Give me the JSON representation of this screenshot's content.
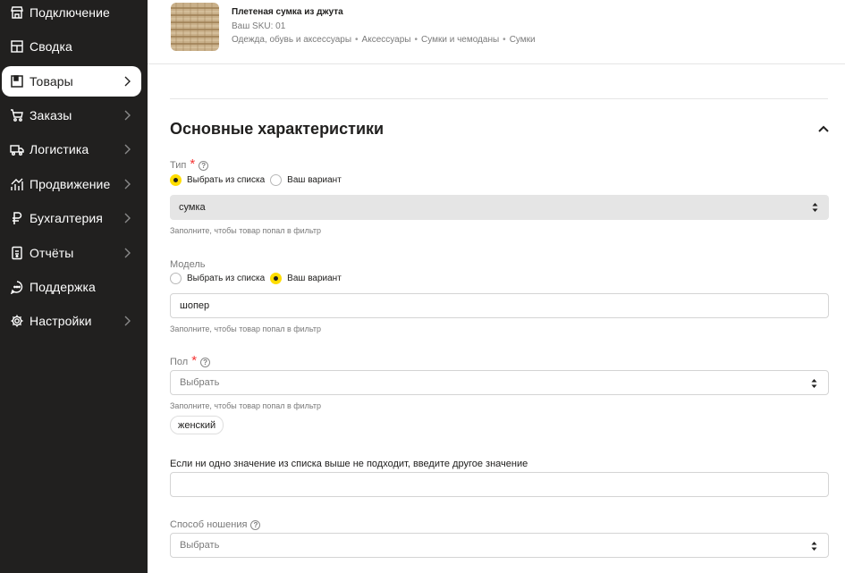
{
  "sidebar": {
    "items": [
      {
        "label": "Подключение",
        "icon": "store-icon",
        "chevron": false
      },
      {
        "label": "Сводка",
        "icon": "summary-icon",
        "chevron": false
      },
      {
        "label": "Товары",
        "icon": "box-icon",
        "chevron": true,
        "active": true
      },
      {
        "label": "Заказы",
        "icon": "cart-icon",
        "chevron": true
      },
      {
        "label": "Логистика",
        "icon": "truck-icon",
        "chevron": true
      },
      {
        "label": "Продвижение",
        "icon": "growth-icon",
        "chevron": true
      },
      {
        "label": "Бухгалтерия",
        "icon": "ruble-icon",
        "chevron": true
      },
      {
        "label": "Отчёты",
        "icon": "report-icon",
        "chevron": true
      },
      {
        "label": "Поддержка",
        "icon": "chat-icon",
        "chevron": false
      },
      {
        "label": "Настройки",
        "icon": "gear-icon",
        "chevron": true
      }
    ]
  },
  "product": {
    "title": "Плетеная сумка из джута",
    "sku": "Ваш SKU: 01",
    "breadcrumb": [
      "Одежда, обувь и аксессуары",
      "Аксессуары",
      "Сумки и чемоданы",
      "Сумки"
    ],
    "separator": "•"
  },
  "section": {
    "title": "Основные характеристики"
  },
  "fields": {
    "type": {
      "label": "Тип",
      "required_mark": "*",
      "help": "?",
      "radio_list": "Выбрать из списка",
      "radio_custom": "Ваш вариант",
      "selected_mode": "list",
      "value": "сумка",
      "hint": "Заполните, чтобы товар попал в фильтр"
    },
    "model": {
      "label": "Модель",
      "radio_list": "Выбрать из списка",
      "radio_custom": "Ваш вариант",
      "selected_mode": "custom",
      "value": "шопер",
      "hint": "Заполните, чтобы товар попал в фильтр"
    },
    "gender": {
      "label": "Пол",
      "required_mark": "*",
      "help": "?",
      "placeholder": "Выбрать",
      "hint": "Заполните, чтобы товар попал в фильтр",
      "chip": "женский"
    },
    "custom_value": {
      "label": "Если ни одно значение из списка выше не подходит, введите другое значение",
      "value": ""
    },
    "wear_method": {
      "label": "Способ ношения",
      "help": "?",
      "placeholder": "Выбрать"
    }
  },
  "colors": {
    "sidebar_bg": "#21201f",
    "accent": "#ffdd00",
    "required": "#f53333"
  }
}
